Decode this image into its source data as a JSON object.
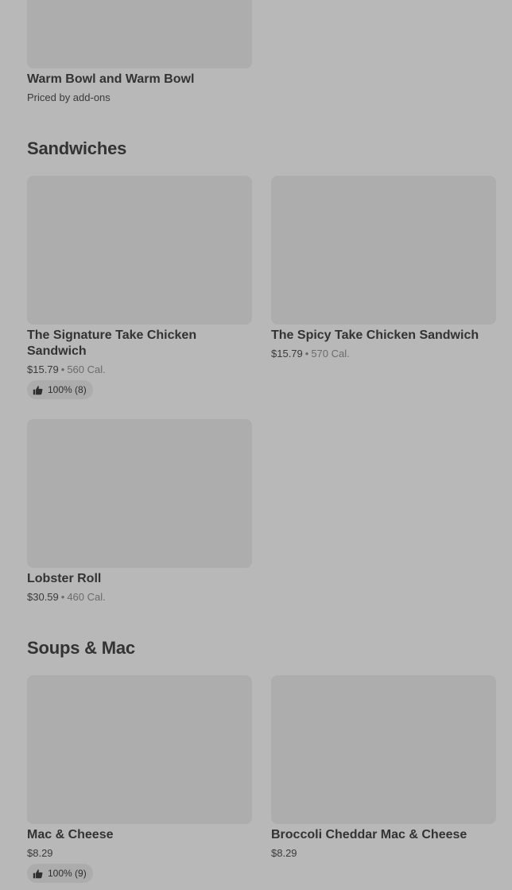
{
  "top_item": {
    "name": "Warm Bowl and Warm Bowl",
    "subtext": "Priced by add-ons"
  },
  "sections": [
    {
      "title": "Sandwiches",
      "items": [
        {
          "name": "The Signature Take Chicken Sandwich",
          "price": "$15.79",
          "separator": "•",
          "calories": "560 Cal.",
          "rating": "100% (8)"
        },
        {
          "name": "The Spicy Take Chicken Sandwich",
          "price": "$15.79",
          "separator": "•",
          "calories": "570 Cal."
        },
        {
          "name": "Lobster Roll",
          "price": "$30.59",
          "separator": "•",
          "calories": "460 Cal."
        }
      ]
    },
    {
      "title": "Soups & Mac",
      "items": [
        {
          "name": "Mac & Cheese",
          "price": "$8.29",
          "rating": "100% (9)"
        },
        {
          "name": "Broccoli Cheddar Mac & Cheese",
          "price": "$8.29"
        }
      ]
    }
  ],
  "icons": {
    "rating": "thumbs-up-icon"
  },
  "colors": {
    "background": "#b8b8b8",
    "image_placeholder": "#adadad",
    "text": "#333333"
  }
}
